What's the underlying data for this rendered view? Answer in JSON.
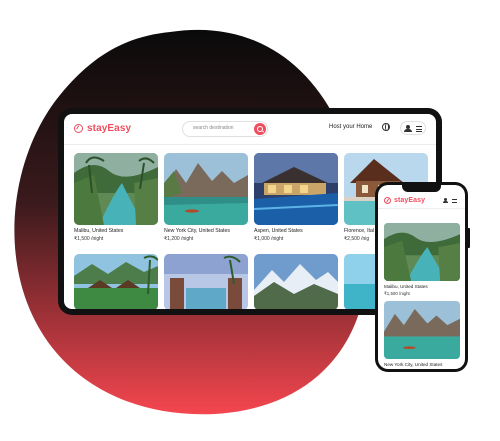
{
  "brand": {
    "name": "stayEasy",
    "color": "#f04d5e"
  },
  "search": {
    "placeholder": "search destination"
  },
  "nav": {
    "host_label": "Host your Home",
    "globe_icon": "globe-icon",
    "user_icon": "user-icon",
    "menu_icon": "menu-icon"
  },
  "listings": [
    {
      "title": "Malibu, United States",
      "price": "₹1,500 /night"
    },
    {
      "title": "New York City, United States",
      "price": "₹1,200 /night"
    },
    {
      "title": "Aspen, United States",
      "price": "₹1,000 /night"
    },
    {
      "title": "Florence, Ital",
      "price": "₹2,500 /nig"
    }
  ],
  "phone_listings": [
    {
      "title": "Malibu, United States",
      "price": "₹1,500 /night"
    },
    {
      "title": "New York City, United States"
    }
  ],
  "colors": {
    "blob_top": "#0a0a0a",
    "blob_bottom": "#f4464f"
  }
}
